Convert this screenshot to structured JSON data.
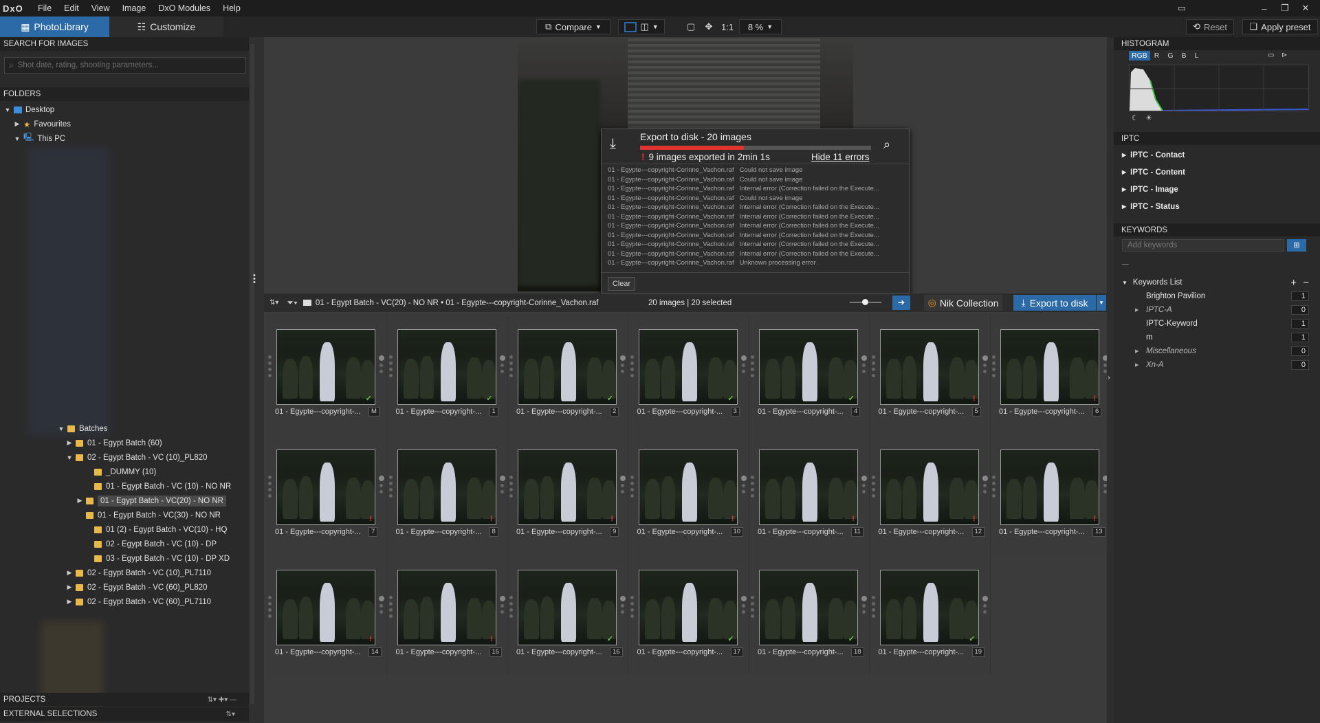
{
  "menu": {
    "logo": "DxO",
    "items": [
      "File",
      "Edit",
      "View",
      "Image",
      "DxO Modules",
      "Help"
    ]
  },
  "tabs": {
    "photolibrary": "PhotoLibrary",
    "customize": "Customize"
  },
  "toolbar": {
    "compare": "Compare",
    "one_to_one": "1:1",
    "zoom": "8 %",
    "reset": "Reset",
    "apply_preset": "Apply preset"
  },
  "left": {
    "search_header": "SEARCH FOR IMAGES",
    "search_placeholder": "Shot date, rating, shooting parameters...",
    "folders_header": "FOLDERS",
    "tree_top": [
      {
        "label": "Desktop"
      },
      {
        "label": "Favourites"
      },
      {
        "label": "This PC"
      }
    ],
    "batches": [
      {
        "label": "Batches",
        "expanded": true
      },
      {
        "label": "01 - Egypt Batch (60)",
        "expanded": false
      },
      {
        "label": "02 - Egypt Batch  - VC (10)_PL820",
        "expanded": true
      },
      {
        "label": "_DUMMY (10)"
      },
      {
        "label": "01 - Egypt Batch - VC (10) - NO NR"
      },
      {
        "label": "01 - Egypt Batch - VC(20) - NO NR",
        "selected": true,
        "expanded": false
      },
      {
        "label": "01 - Egypt Batch - VC(30) - NO NR"
      },
      {
        "label": "01 (2) - Egypt Batch - VC(10) - HQ"
      },
      {
        "label": "02 - Egypt Batch - VC (10) - DP"
      },
      {
        "label": "03 - Egypt Batch - VC (10) - DP XD"
      },
      {
        "label": "02 - Egypt Batch  - VC (10)_PL7110",
        "expanded": false
      },
      {
        "label": "02 - Egypt Batch  - VC (60)_PL820",
        "expanded": false
      },
      {
        "label": "02 - Egypt Batch  - VC (60)_PL7110",
        "expanded": false
      }
    ],
    "projects": "PROJECTS",
    "external": "EXTERNAL SELECTIONS"
  },
  "popup": {
    "title": "Export to disk - 20 images",
    "status": "9 images exported in 2min 1s",
    "hide_errors": "Hide 11 errors",
    "progress": 0.45,
    "clear": "Clear",
    "errors": [
      {
        "file": "01 - Egypte---copyright-Corinne_Vachon.raf",
        "msg": "Could not save image"
      },
      {
        "file": "01 - Egypte---copyright-Corinne_Vachon.raf",
        "msg": "Could not save image"
      },
      {
        "file": "01 - Egypte---copyright-Corinne_Vachon.raf",
        "msg": "Internal error (Correction failed on the Execute..."
      },
      {
        "file": "01 - Egypte---copyright-Corinne_Vachon.raf",
        "msg": "Could not save image"
      },
      {
        "file": "01 - Egypte---copyright-Corinne_Vachon.raf",
        "msg": "Internal error (Correction failed on the Execute..."
      },
      {
        "file": "01 - Egypte---copyright-Corinne_Vachon.raf",
        "msg": "Internal error (Correction failed on the Execute..."
      },
      {
        "file": "01 - Egypte---copyright-Corinne_Vachon.raf",
        "msg": "Internal error (Correction failed on the Execute..."
      },
      {
        "file": "01 - Egypte---copyright-Corinne_Vachon.raf",
        "msg": "Internal error (Correction failed on the Execute..."
      },
      {
        "file": "01 - Egypte---copyright-Corinne_Vachon.raf",
        "msg": "Internal error (Correction failed on the Execute..."
      },
      {
        "file": "01 - Egypte---copyright-Corinne_Vachon.raf",
        "msg": "Internal error (Correction failed on the Execute..."
      },
      {
        "file": "01 - Egypte---copyright-Corinne_Vachon.raf",
        "msg": "Unknown processing error"
      }
    ]
  },
  "browser": {
    "breadcrumb": "01 - Egypt Batch - VC(20) - NO NR  •  01 - Egypte---copyright-Corinne_Vachon.raf",
    "count": "20 images | 20 selected",
    "nik": "Nik Collection",
    "export": "Export to disk",
    "thumbs": [
      {
        "caption": "01 - Egypte---copyright-...",
        "num": "M",
        "status": "ok"
      },
      {
        "caption": "01 - Egypte---copyright-...",
        "num": "1",
        "status": "ok"
      },
      {
        "caption": "01 - Egypte---copyright-...",
        "num": "2",
        "status": "ok"
      },
      {
        "caption": "01 - Egypte---copyright-...",
        "num": "3",
        "status": "ok"
      },
      {
        "caption": "01 - Egypte---copyright-...",
        "num": "4",
        "status": "ok"
      },
      {
        "caption": "01 - Egypte---copyright-...",
        "num": "5",
        "status": "error"
      },
      {
        "caption": "01 - Egypte---copyright-...",
        "num": "6",
        "status": "error"
      },
      {
        "caption": "01 - Egypte---copyright-...",
        "num": "7",
        "status": "error"
      },
      {
        "caption": "01 - Egypte---copyright-...",
        "num": "8",
        "status": "error"
      },
      {
        "caption": "01 - Egypte---copyright-...",
        "num": "9",
        "status": "error"
      },
      {
        "caption": "01 - Egypte---copyright-...",
        "num": "10",
        "status": "error"
      },
      {
        "caption": "01 - Egypte---copyright-...",
        "num": "11",
        "status": "error"
      },
      {
        "caption": "01 - Egypte---copyright-...",
        "num": "12",
        "status": "error"
      },
      {
        "caption": "01 - Egypte---copyright-...",
        "num": "13",
        "status": "error"
      },
      {
        "caption": "01 - Egypte---copyright-...",
        "num": "14",
        "status": "error"
      },
      {
        "caption": "01 - Egypte---copyright-...",
        "num": "15",
        "status": "error"
      },
      {
        "caption": "01 - Egypte---copyright-...",
        "num": "16",
        "status": "ok"
      },
      {
        "caption": "01 - Egypte---copyright-...",
        "num": "17",
        "status": "ok"
      },
      {
        "caption": "01 - Egypte---copyright-...",
        "num": "18",
        "status": "ok"
      },
      {
        "caption": "01 - Egypte---copyright-...",
        "num": "19",
        "status": "ok"
      }
    ]
  },
  "right": {
    "histogram": "HISTOGRAM",
    "channels": [
      "RGB",
      "R",
      "G",
      "B",
      "L"
    ],
    "iptc": "IPTC",
    "iptc_items": [
      "IPTC - Contact",
      "IPTC - Content",
      "IPTC - Image",
      "IPTC - Status"
    ],
    "keywords": "KEYWORDS",
    "add_keywords": "Add keywords",
    "keywords_list": "Keywords List",
    "kw": [
      {
        "label": "Brighton Pavilion",
        "count": "1",
        "italic": false,
        "expandable": false
      },
      {
        "label": "IPTC-A",
        "count": "0",
        "italic": true,
        "expandable": true
      },
      {
        "label": "IPTC-Keyword",
        "count": "1",
        "italic": false,
        "expandable": false
      },
      {
        "label": "m",
        "count": "1",
        "italic": false,
        "expandable": false
      },
      {
        "label": "Miscellaneous",
        "count": "0",
        "italic": true,
        "expandable": true
      },
      {
        "label": "Xn-A",
        "count": "0",
        "italic": true,
        "expandable": true
      }
    ]
  },
  "colors": {
    "accent": "#2b6aa6",
    "ok": "#6cc04a",
    "error": "#e0342c"
  }
}
